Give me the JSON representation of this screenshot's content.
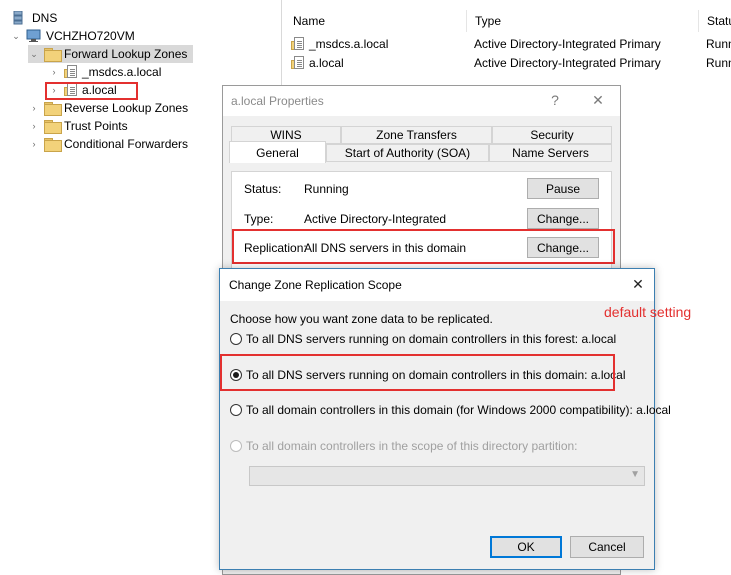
{
  "tree": {
    "root": "DNS",
    "server": "VCHZHO720VM",
    "forward_zones": "Forward Lookup Zones",
    "msdcs": "_msdcs.a.local",
    "alocal": "a.local",
    "reverse_zones": "Reverse Lookup Zones",
    "trust_points": "Trust Points",
    "conditional_forwarders": "Conditional Forwarders"
  },
  "list": {
    "columns": [
      "Name",
      "Type",
      "Status"
    ],
    "col_status_visible": "Statu",
    "rows": [
      {
        "name": "_msdcs.a.local",
        "type": "Active Directory-Integrated Primary",
        "status": "Runn"
      },
      {
        "name": "a.local",
        "type": "Active Directory-Integrated Primary",
        "status": "Runn"
      }
    ]
  },
  "props_dialog": {
    "title": "a.local Properties",
    "help": "?",
    "close": "✕",
    "tabs_row1": [
      "WINS",
      "Zone Transfers",
      "Security"
    ],
    "tabs_row2": [
      "General",
      "Start of Authority (SOA)",
      "Name Servers"
    ],
    "status_label": "Status:",
    "status_value": "Running",
    "pause_button": "Pause",
    "type_label": "Type:",
    "type_value": "Active Directory-Integrated",
    "change_button": "Change...",
    "replication_label": "Replication:",
    "replication_value": "All DNS servers in this domain",
    "change_button2": "Change..."
  },
  "scope_dialog": {
    "title": "Change Zone Replication Scope",
    "close": "✕",
    "prompt": "Choose how you want zone data to be replicated.",
    "options": [
      "To all DNS servers running on domain controllers in this forest: a.local",
      "To all DNS servers running on domain controllers in this domain: a.local",
      "To all domain controllers in this domain (for Windows 2000 compatibility): a.local",
      "To all domain controllers in the scope of this directory partition:"
    ],
    "selected_index": 1,
    "ok_button": "OK",
    "cancel_button": "Cancel"
  },
  "annotation": "default setting",
  "colors": {
    "highlight": "#e3302f",
    "accent": "#0078d7",
    "selection": "#d9d9d9"
  }
}
